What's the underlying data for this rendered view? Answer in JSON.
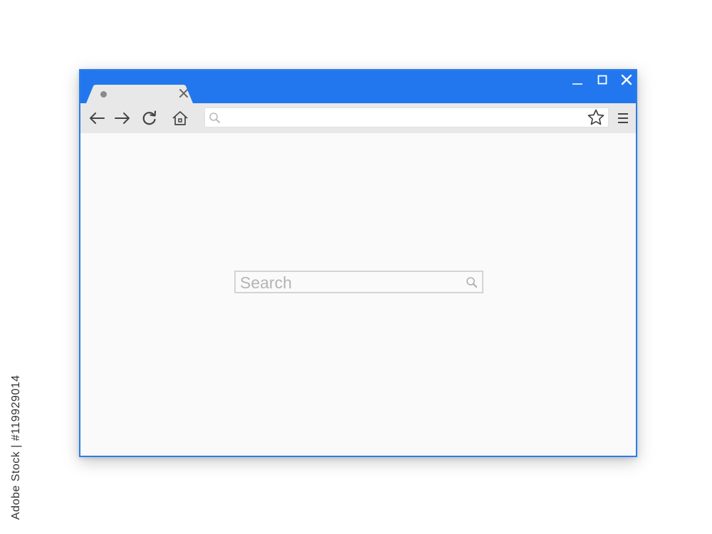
{
  "colors": {
    "title_bar": "#2277ee",
    "window_border": "#2b7de9",
    "toolbar": "#e8e8e8",
    "tab": "#e8e8e8",
    "content": "#fafafa",
    "search_border": "#d4d4d4",
    "icon": "#444444"
  },
  "window": {
    "controls": {
      "minimize_icon": "minimize-icon",
      "maximize_icon": "maximize-icon",
      "close_icon": "close-icon"
    }
  },
  "tab": {
    "indicator_icon": "tab-dot-icon",
    "close_icon": "close-icon"
  },
  "toolbar": {
    "icons": [
      "arrow-left-icon",
      "arrow-right-icon",
      "reload-icon",
      "home-icon",
      "search-icon",
      "star-icon",
      "hamburger-menu-icon"
    ],
    "address_value": ""
  },
  "content": {
    "search": {
      "placeholder": "Search",
      "value": "",
      "icon": "search-icon"
    }
  },
  "watermark": {
    "stock_id": "Adobe Stock | #119929014"
  }
}
